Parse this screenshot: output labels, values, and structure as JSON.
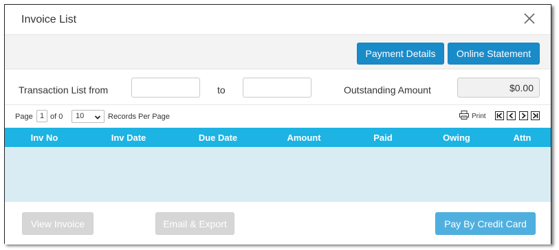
{
  "dialog": {
    "title": "Invoice List"
  },
  "toolbar": {
    "payment_details": "Payment Details",
    "online_statement": "Online Statement"
  },
  "filters": {
    "from_label": "Transaction List from",
    "to_label": "to",
    "from_value": "",
    "to_value": "",
    "outstanding_label": "Outstanding Amount",
    "outstanding_value": "$0.00"
  },
  "pager": {
    "page_label": "Page",
    "page_value": "1",
    "of_label": "of 0",
    "per_page_value": "10",
    "records_label": "Records Per Page",
    "print_label": "Print"
  },
  "table": {
    "columns": [
      "Inv No",
      "Inv Date",
      "Due Date",
      "Amount",
      "Paid",
      "Owing",
      "Attn"
    ],
    "rows": []
  },
  "footer": {
    "view_invoice": "View Invoice",
    "email_export": "Email & Export",
    "pay_credit_card": "Pay By Credit Card"
  },
  "colors": {
    "primary_button": "#1a8bc9",
    "table_header": "#1db3e3",
    "table_body": "#d9ecf3",
    "disabled_button": "#d6d6d6",
    "pay_button": "#4fb0e0"
  },
  "icons": [
    "close-icon",
    "printer-icon",
    "first-page-icon",
    "prev-page-icon",
    "next-page-icon",
    "last-page-icon",
    "chevron-down-icon"
  ]
}
